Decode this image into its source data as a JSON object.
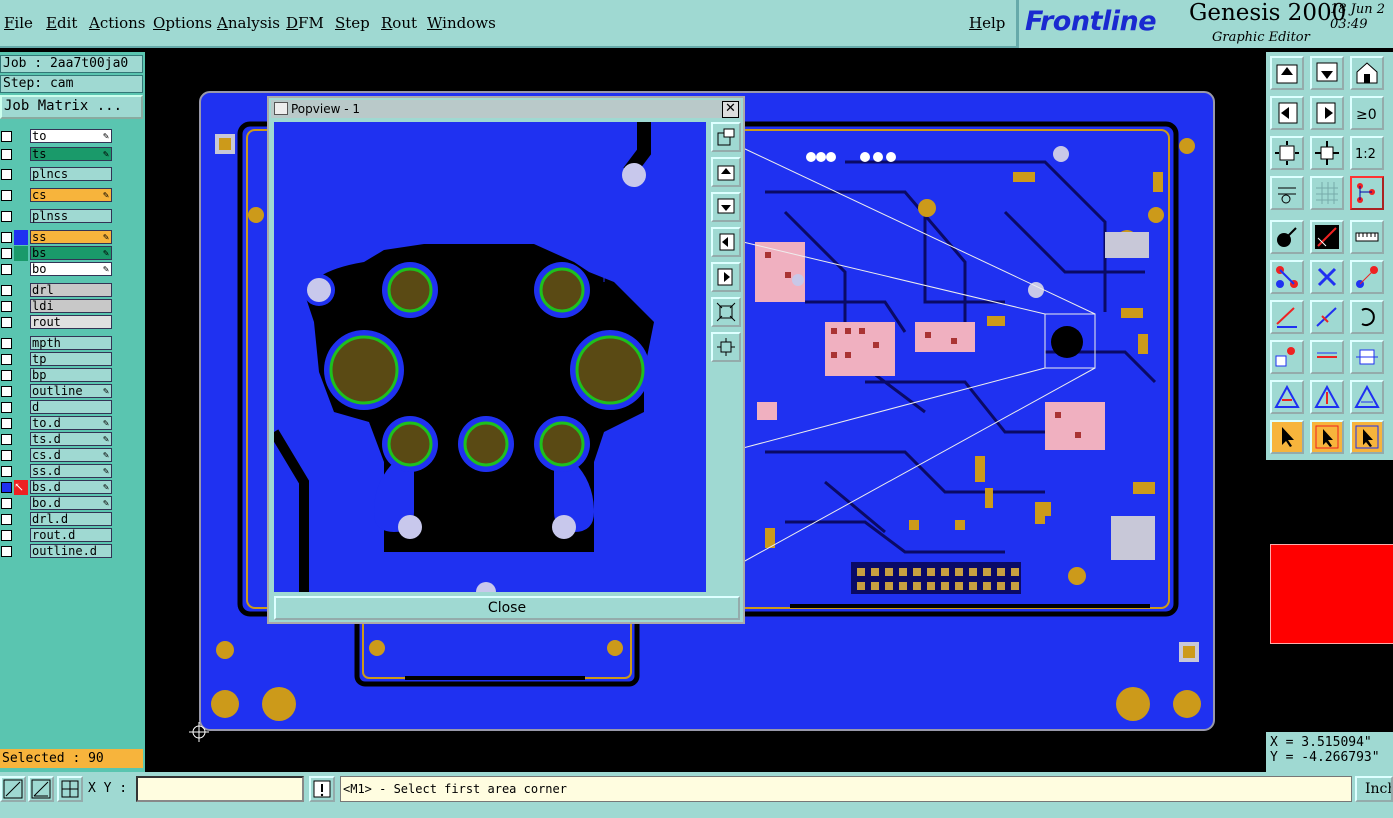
{
  "menus": [
    "File",
    "Edit",
    "Actions",
    "Options",
    "Analysis",
    "DFM",
    "Step",
    "Rout",
    "Windows"
  ],
  "help": "Help",
  "brand": {
    "logo": "Frontline",
    "product": "Genesis 2000",
    "subtitle": "Graphic Editor",
    "date": "18 Jun 2",
    "time": "03:49"
  },
  "job": "Job : 2aa7t00ja0",
  "step": "Step: cam",
  "job_matrix": "Job Matrix ...",
  "layers": [
    {
      "name": "to",
      "color": "#ffffff",
      "pen": true
    },
    {
      "name": "ts",
      "color": "#1a9a6a",
      "pen": true
    },
    {
      "name": "plncs",
      "color": "#9fd9d2",
      "pen": false
    },
    {
      "name": "cs",
      "color": "#f7b43c",
      "pen": true
    },
    {
      "name": "plnss",
      "color": "#9fd9d2",
      "pen": false
    },
    {
      "name": "ss",
      "color": "#f7b43c",
      "pen": true
    },
    {
      "name": "bs",
      "color": "#1a9a6a",
      "pen": true
    },
    {
      "name": "bo",
      "color": "#ffffff",
      "pen": true
    },
    {
      "name": "drl",
      "color": "#c8c8c8",
      "pen": false
    },
    {
      "name": "ldi",
      "color": "#c8c8c8",
      "pen": false
    },
    {
      "name": "rout",
      "color": "#e0e0e0",
      "pen": false
    },
    {
      "name": "mpth",
      "color": "#9fd9d2",
      "pen": false
    },
    {
      "name": "tp",
      "color": "#9fd9d2",
      "pen": false
    },
    {
      "name": "bp",
      "color": "#9fd9d2",
      "pen": false
    },
    {
      "name": "outline",
      "color": "#9fd9d2",
      "pen": true
    },
    {
      "name": "d",
      "color": "#9fd9d2",
      "pen": false
    },
    {
      "name": "to.d",
      "color": "#9fd9d2",
      "pen": true
    },
    {
      "name": "ts.d",
      "color": "#9fd9d2",
      "pen": true
    },
    {
      "name": "cs.d",
      "color": "#9fd9d2",
      "pen": true
    },
    {
      "name": "ss.d",
      "color": "#9fd9d2",
      "pen": true
    },
    {
      "name": "bs.d",
      "color": "#9fd9d2",
      "pen": true
    },
    {
      "name": "bo.d",
      "color": "#9fd9d2",
      "pen": true
    },
    {
      "name": "drl.d",
      "color": "#9fd9d2",
      "pen": false
    },
    {
      "name": "rout.d",
      "color": "#9fd9d2",
      "pen": false
    },
    {
      "name": "outline.d",
      "color": "#9fd9d2",
      "pen": false
    }
  ],
  "selected": "Selected : 90",
  "popview": {
    "title": "Popview - 1",
    "close": "Close"
  },
  "xy_label": "X Y :",
  "xy_value": "",
  "message": "<M1> - Select first area corner",
  "coords": {
    "x": "X = 3.515094\"",
    "y": "Y = -4.266793\""
  },
  "units": "Inch",
  "colors": {
    "board": "#1f31f1",
    "copper": "#cc9a1a",
    "panel": "#9fd9d2",
    "teal": "#5ac5b0",
    "highlight": "#ff0000"
  }
}
